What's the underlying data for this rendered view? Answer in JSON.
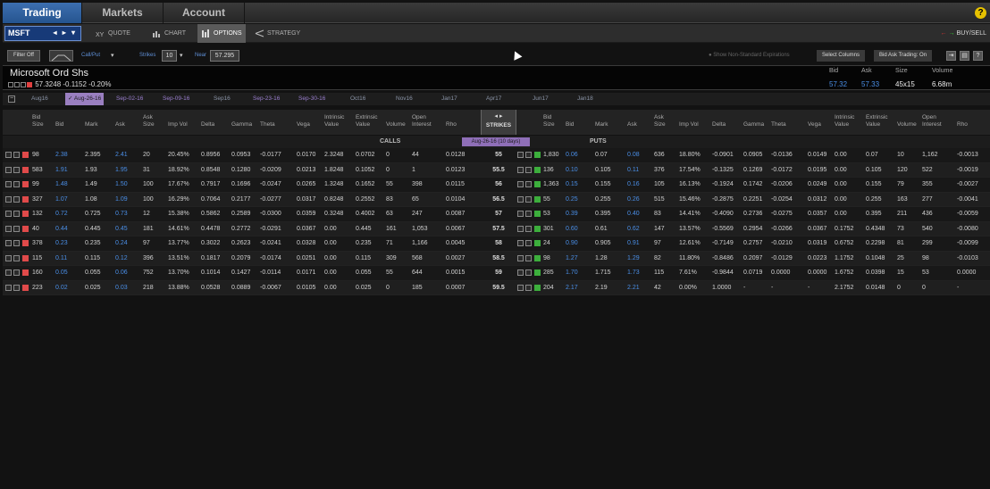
{
  "nav": {
    "tabs": [
      "Trading",
      "Markets",
      "Account"
    ],
    "active": 0,
    "help": "?"
  },
  "toolbar": {
    "symbol": "MSFT",
    "buttons": [
      {
        "label": "QUOTE",
        "icon": "quote-icon"
      },
      {
        "label": "CHART",
        "icon": "chart-icon"
      },
      {
        "label": "OPTIONS",
        "icon": "options-icon",
        "active": true
      },
      {
        "label": "STRATEGY",
        "icon": "strategy-icon"
      }
    ],
    "buysell": "BUY/SELL"
  },
  "filters": {
    "filter_off": "Filter Off",
    "callput_label": "Call/Put",
    "strikes_label": "Strikes",
    "strikes_value": "10",
    "near_label": "Near",
    "near_value": "57.295",
    "nonstandard": "Show Non-Standard Expirations",
    "select_columns": "Select Columns",
    "bid_ask_trading": "Bid Ask Trading: On"
  },
  "quote": {
    "name": "Microsoft Ord Shs",
    "last": "57.3248",
    "change": "-0.1152",
    "change_pct": "-0.20%",
    "headers": {
      "bid": "Bid",
      "ask": "Ask",
      "size": "Size",
      "volume": "Volume"
    },
    "bid": "57.32",
    "ask": "57.33",
    "size": "45x15",
    "volume": "6.68m"
  },
  "expirations": [
    "Aug16",
    "Aug-26-16",
    "Sep-02-16",
    "Sep-09-16",
    "Sep16",
    "Sep-23-16",
    "Sep-30-16",
    "Oct16",
    "Nov16",
    "Jan17",
    "Apr17",
    "Jun17",
    "Jan18"
  ],
  "selected_expiration": 1,
  "columns": {
    "calls": [
      "Bid Size",
      "Bid",
      "Mark",
      "Ask",
      "Ask Size",
      "Imp Vol",
      "Delta",
      "Gamma",
      "Theta",
      "Vega",
      "Intrinsic Value",
      "Extrinsic Value",
      "Volume",
      "Open Interest",
      "Rho"
    ],
    "strikes": "STRIKES",
    "puts": [
      "Bid Size",
      "Bid",
      "Mark",
      "Ask",
      "Ask Size",
      "Imp Vol",
      "Delta",
      "Gamma",
      "Theta",
      "Vega",
      "Intrinsic Value",
      "Extrinsic Value",
      "Volume",
      "Open Interest",
      "Rho"
    ]
  },
  "sections": {
    "calls": "CALLS",
    "puts": "PUTS",
    "date": "Aug-26-16  (10 days)"
  },
  "rows": [
    {
      "calls": [
        "98",
        "2.38",
        "2.395",
        "2.41",
        "20",
        "20.45%",
        "0.8956",
        "0.0953",
        "-0.0177",
        "0.0170",
        "2.3248",
        "0.0702",
        "0",
        "44",
        "0.0128"
      ],
      "strike": "55",
      "puts": [
        "1,830",
        "0.06",
        "0.07",
        "0.08",
        "636",
        "18.80%",
        "-0.0901",
        "0.0905",
        "-0.0136",
        "0.0149",
        "0.00",
        "0.07",
        "10",
        "1,162",
        "-0.0013"
      ]
    },
    {
      "calls": [
        "583",
        "1.91",
        "1.93",
        "1.95",
        "31",
        "18.92%",
        "0.8548",
        "0.1280",
        "-0.0209",
        "0.0213",
        "1.8248",
        "0.1052",
        "0",
        "1",
        "0.0123"
      ],
      "strike": "55.5",
      "puts": [
        "136",
        "0.10",
        "0.105",
        "0.11",
        "376",
        "17.54%",
        "-0.1325",
        "0.1269",
        "-0.0172",
        "0.0195",
        "0.00",
        "0.105",
        "120",
        "522",
        "-0.0019"
      ]
    },
    {
      "calls": [
        "99",
        "1.48",
        "1.49",
        "1.50",
        "100",
        "17.67%",
        "0.7917",
        "0.1696",
        "-0.0247",
        "0.0265",
        "1.3248",
        "0.1652",
        "55",
        "398",
        "0.0115"
      ],
      "strike": "56",
      "puts": [
        "1,363",
        "0.15",
        "0.155",
        "0.16",
        "105",
        "16.13%",
        "-0.1924",
        "0.1742",
        "-0.0206",
        "0.0249",
        "0.00",
        "0.155",
        "79",
        "355",
        "-0.0027"
      ]
    },
    {
      "calls": [
        "327",
        "1.07",
        "1.08",
        "1.09",
        "100",
        "16.29%",
        "0.7064",
        "0.2177",
        "-0.0277",
        "0.0317",
        "0.8248",
        "0.2552",
        "83",
        "65",
        "0.0104"
      ],
      "strike": "56.5",
      "puts": [
        "55",
        "0.25",
        "0.255",
        "0.26",
        "515",
        "15.46%",
        "-0.2875",
        "0.2251",
        "-0.0254",
        "0.0312",
        "0.00",
        "0.255",
        "163",
        "277",
        "-0.0041"
      ]
    },
    {
      "calls": [
        "132",
        "0.72",
        "0.725",
        "0.73",
        "12",
        "15.38%",
        "0.5862",
        "0.2589",
        "-0.0300",
        "0.0359",
        "0.3248",
        "0.4002",
        "63",
        "247",
        "0.0087"
      ],
      "strike": "57",
      "puts": [
        "53",
        "0.39",
        "0.395",
        "0.40",
        "83",
        "14.41%",
        "-0.4090",
        "0.2736",
        "-0.0275",
        "0.0357",
        "0.00",
        "0.395",
        "211",
        "436",
        "-0.0059"
      ]
    },
    {
      "calls": [
        "40",
        "0.44",
        "0.445",
        "0.45",
        "181",
        "14.61%",
        "0.4478",
        "0.2772",
        "-0.0291",
        "0.0367",
        "0.00",
        "0.445",
        "161",
        "1,053",
        "0.0067"
      ],
      "strike": "57.5",
      "puts": [
        "301",
        "0.60",
        "0.61",
        "0.62",
        "147",
        "13.57%",
        "-0.5569",
        "0.2954",
        "-0.0266",
        "0.0367",
        "0.1752",
        "0.4348",
        "73",
        "540",
        "-0.0080"
      ]
    },
    {
      "calls": [
        "378",
        "0.23",
        "0.235",
        "0.24",
        "97",
        "13.77%",
        "0.3022",
        "0.2623",
        "-0.0241",
        "0.0328",
        "0.00",
        "0.235",
        "71",
        "1,166",
        "0.0045"
      ],
      "strike": "58",
      "puts": [
        "24",
        "0.90",
        "0.905",
        "0.91",
        "97",
        "12.61%",
        "-0.7149",
        "0.2757",
        "-0.0210",
        "0.0319",
        "0.6752",
        "0.2298",
        "81",
        "299",
        "-0.0099"
      ]
    },
    {
      "calls": [
        "115",
        "0.11",
        "0.115",
        "0.12",
        "396",
        "13.51%",
        "0.1817",
        "0.2079",
        "-0.0174",
        "0.0251",
        "0.00",
        "0.115",
        "309",
        "568",
        "0.0027"
      ],
      "strike": "58.5",
      "puts": [
        "98",
        "1.27",
        "1.28",
        "1.29",
        "82",
        "11.80%",
        "-0.8486",
        "0.2097",
        "-0.0129",
        "0.0223",
        "1.1752",
        "0.1048",
        "25",
        "98",
        "-0.0103"
      ]
    },
    {
      "calls": [
        "160",
        "0.05",
        "0.055",
        "0.06",
        "752",
        "13.70%",
        "0.1014",
        "0.1427",
        "-0.0114",
        "0.0171",
        "0.00",
        "0.055",
        "55",
        "644",
        "0.0015"
      ],
      "strike": "59",
      "puts": [
        "285",
        "1.70",
        "1.715",
        "1.73",
        "115",
        "7.61%",
        "-0.9844",
        "0.0719",
        "0.0000",
        "0.0000",
        "1.6752",
        "0.0398",
        "15",
        "53",
        "0.0000"
      ]
    },
    {
      "calls": [
        "223",
        "0.02",
        "0.025",
        "0.03",
        "218",
        "13.88%",
        "0.0528",
        "0.0889",
        "-0.0067",
        "0.0105",
        "0.00",
        "0.025",
        "0",
        "185",
        "0.0007"
      ],
      "strike": "59.5",
      "puts": [
        "204",
        "2.17",
        "2.19",
        "2.21",
        "42",
        "0.00%",
        "1.0000",
        "-",
        "-",
        "-",
        "2.1752",
        "0.0148",
        "0",
        "0",
        "-"
      ]
    }
  ],
  "colors": {
    "accent": "#2f63a8",
    "blue_text": "#4a8ee6",
    "call_marker": "#e04a4a",
    "put_marker": "#3cae3c",
    "date_pill": "#8f6fb8"
  }
}
